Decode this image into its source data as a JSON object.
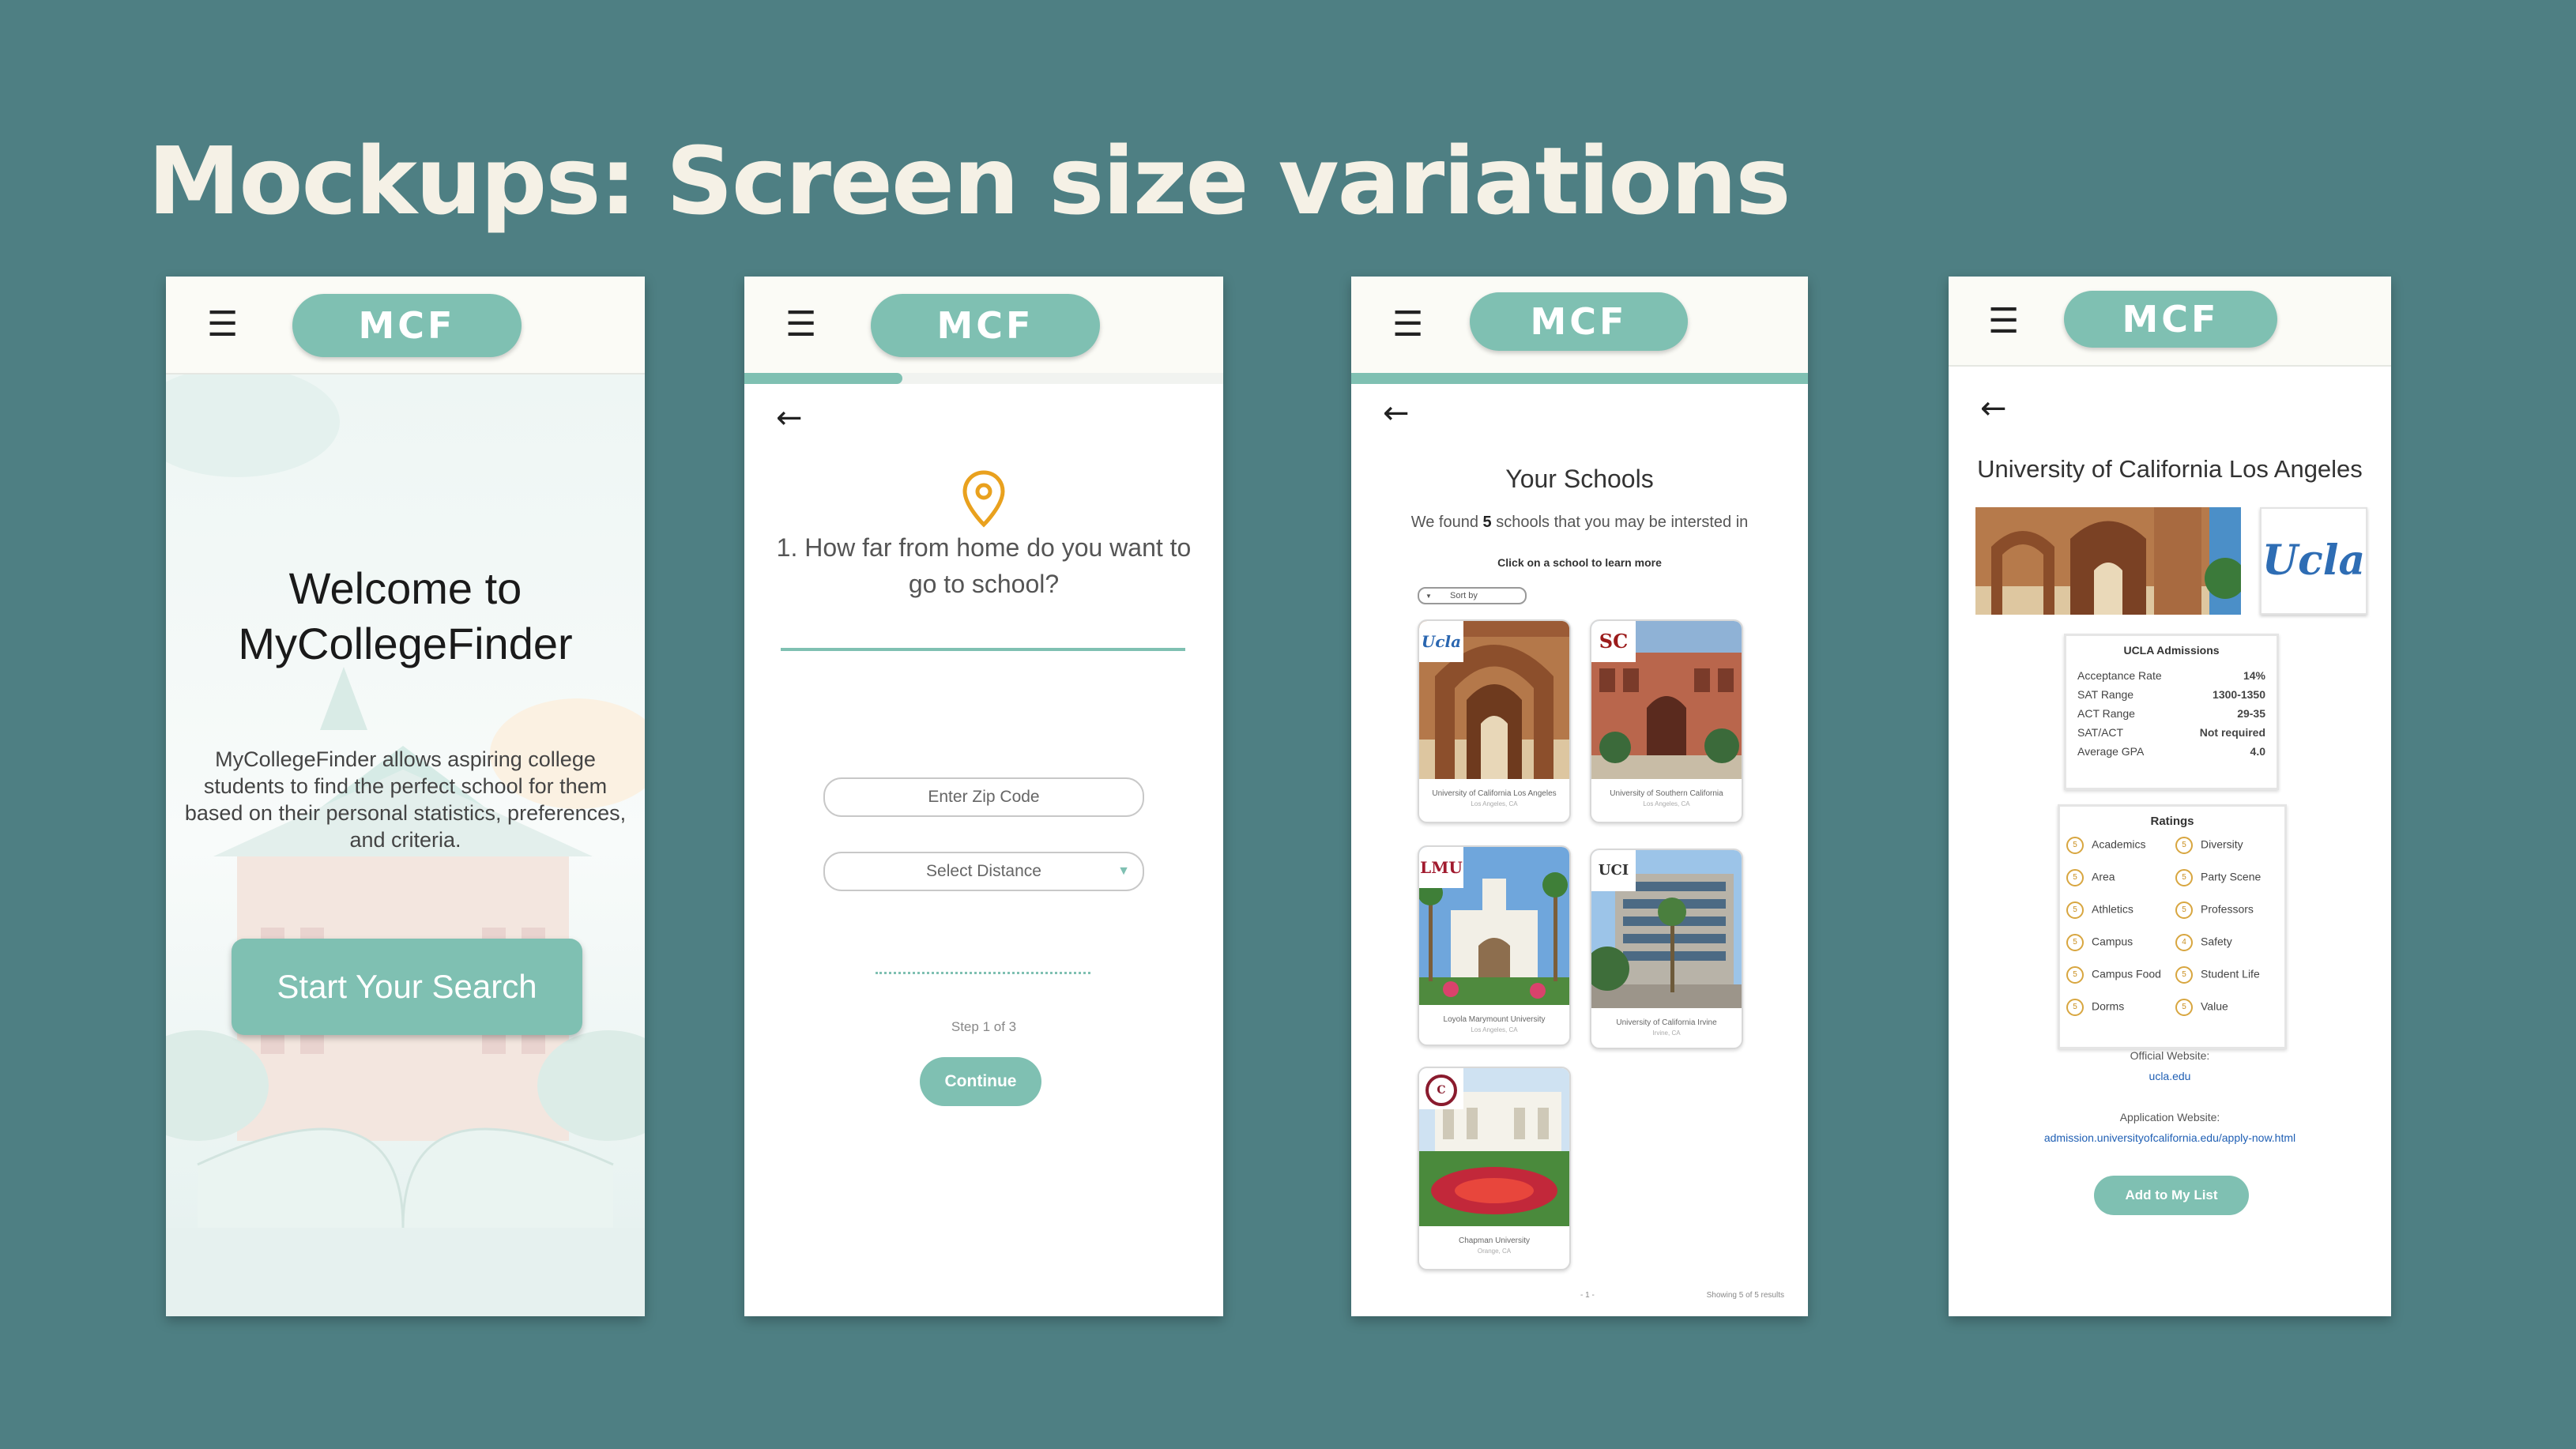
{
  "slide": {
    "title": "Mockups: Screen size variations"
  },
  "brand": {
    "logo": "MCF"
  },
  "colors": {
    "background": "#4e7f83",
    "teal": "#7fc0b2",
    "title": "#f5f1e6",
    "pin": "#e9a11e"
  },
  "icons": {
    "menu": "hamburger-icon",
    "back": "back-arrow-icon",
    "pin": "location-pin-icon"
  },
  "screen1": {
    "heading_line1": "Welcome to",
    "heading_line2": "MyCollegeFinder",
    "description": "MyCollegeFinder allows aspiring college students to find the perfect school for them based on their personal statistics, preferences, and criteria.",
    "cta": "Start Your Search"
  },
  "screen2": {
    "question": "1. How far from home do you want to go to school?",
    "zip_placeholder": "Enter Zip Code",
    "distance_select": "Select Distance",
    "step": "Step 1 of 3",
    "continue": "Continue",
    "progress": 0.33
  },
  "screen3": {
    "title": "Your Schools",
    "found_pre": "We found ",
    "found_count": "5",
    "found_post": " schools that you may be intersted in",
    "hint": "Click on a school to learn more",
    "sort": "Sort by",
    "page": "- 1 -",
    "showing": "Showing 5 of 5 results",
    "schools": [
      {
        "name": "University of California Los Angeles",
        "location": "Los Angeles, CA",
        "badge": "Ucla"
      },
      {
        "name": "University of Southern California",
        "location": "Los Angeles, CA",
        "badge": "SC"
      },
      {
        "name": "Loyola Marymount University",
        "location": "Los Angeles, CA",
        "badge": "LMU"
      },
      {
        "name": "University of California Irvine",
        "location": "Irvine, CA",
        "badge": "UCI"
      },
      {
        "name": "Chapman University",
        "location": "Orange, CA",
        "badge": "C"
      }
    ]
  },
  "screen4": {
    "title": "University of California Los Angeles",
    "logo_text": "Ucla",
    "admissions_title": "UCLA Admissions",
    "admissions": [
      {
        "label": "Acceptance Rate",
        "value": "14%"
      },
      {
        "label": "SAT Range",
        "value": "1300-1350"
      },
      {
        "label": "ACT Range",
        "value": "29-35"
      },
      {
        "label": "SAT/ACT",
        "value": "Not required"
      },
      {
        "label": "Average GPA",
        "value": "4.0"
      }
    ],
    "ratings_title": "Ratings",
    "ratings_left": [
      {
        "label": "Academics",
        "score": "5"
      },
      {
        "label": "Area",
        "score": "5"
      },
      {
        "label": "Athletics",
        "score": "5"
      },
      {
        "label": "Campus",
        "score": "5"
      },
      {
        "label": "Campus Food",
        "score": "5"
      },
      {
        "label": "Dorms",
        "score": "5"
      }
    ],
    "ratings_right": [
      {
        "label": "Diversity",
        "score": "5"
      },
      {
        "label": "Party Scene",
        "score": "5"
      },
      {
        "label": "Professors",
        "score": "5"
      },
      {
        "label": "Safety",
        "score": "4"
      },
      {
        "label": "Student Life",
        "score": "5"
      },
      {
        "label": "Value",
        "score": "5"
      }
    ],
    "official_label": "Official Website:",
    "official_url": "ucla.edu",
    "application_label": "Application Website:",
    "application_url": "admission.universityofcalifornia.edu/apply-now.html",
    "add_button": "Add to My List"
  }
}
